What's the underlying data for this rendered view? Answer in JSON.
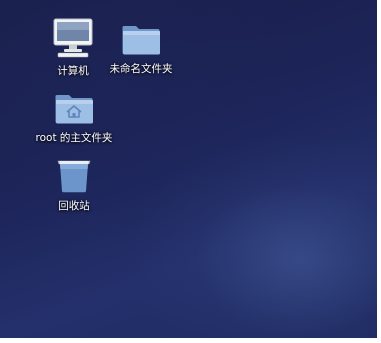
{
  "desktop": {
    "icons": [
      {
        "label": "计算机",
        "icon": "computer-icon"
      },
      {
        "label": "未命名文件夹",
        "icon": "folder-icon"
      },
      {
        "label": "root 的主文件夹",
        "icon": "home-folder-icon"
      },
      {
        "label": "回收站",
        "icon": "trash-icon"
      }
    ]
  },
  "colors": {
    "folder_blue": "#8fb3de",
    "desktop_background": "#1e2658"
  }
}
